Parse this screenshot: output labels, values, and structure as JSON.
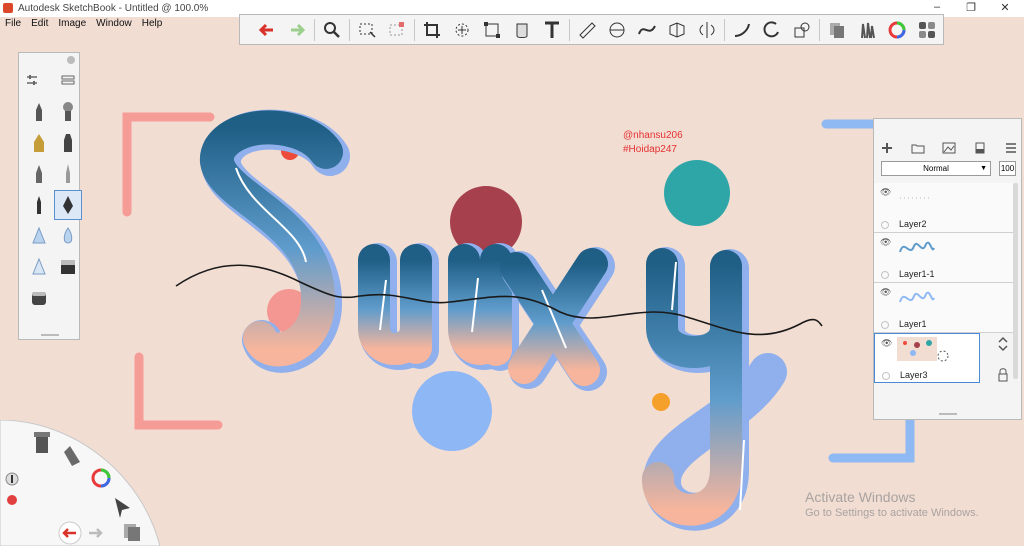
{
  "window": {
    "title": "Autodesk SketchBook - Untitled @ 100.0%",
    "minimize": "–",
    "maximize": "❐",
    "close": "✕"
  },
  "menu": [
    "File",
    "Edit",
    "Image",
    "Window",
    "Help"
  ],
  "canvas": {
    "credit_line1": "@nhansu206",
    "credit_line2": "#Hoidap247",
    "watermark_title": "Activate Windows",
    "watermark_sub": "Go to Settings to activate Windows."
  },
  "toolbar": {
    "tools": [
      "undo-icon",
      "redo-icon",
      "zoom-icon",
      "select-icon",
      "lasso-icon",
      "crop-icon",
      "transform-icon",
      "distort-icon",
      "fill-icon",
      "text-icon",
      "ruler-icon",
      "ellipse-guide-icon",
      "french-curve-icon",
      "perspective-icon",
      "symmetry-icon",
      "curve-icon",
      "circle-icon",
      "shape-icon",
      "copic-icon",
      "brushes-icon",
      "color-wheel-icon",
      "grid-icon"
    ]
  },
  "layers": {
    "blend_mode": "Normal",
    "opacity": "100",
    "items": [
      {
        "name": "Layer2"
      },
      {
        "name": "Layer1-1"
      },
      {
        "name": "Layer1"
      },
      {
        "name": "Layer3"
      }
    ]
  },
  "colors": {
    "background": "#f2ddd3",
    "accent_select": "#4a8ad4",
    "credit_red": "#e53131"
  }
}
